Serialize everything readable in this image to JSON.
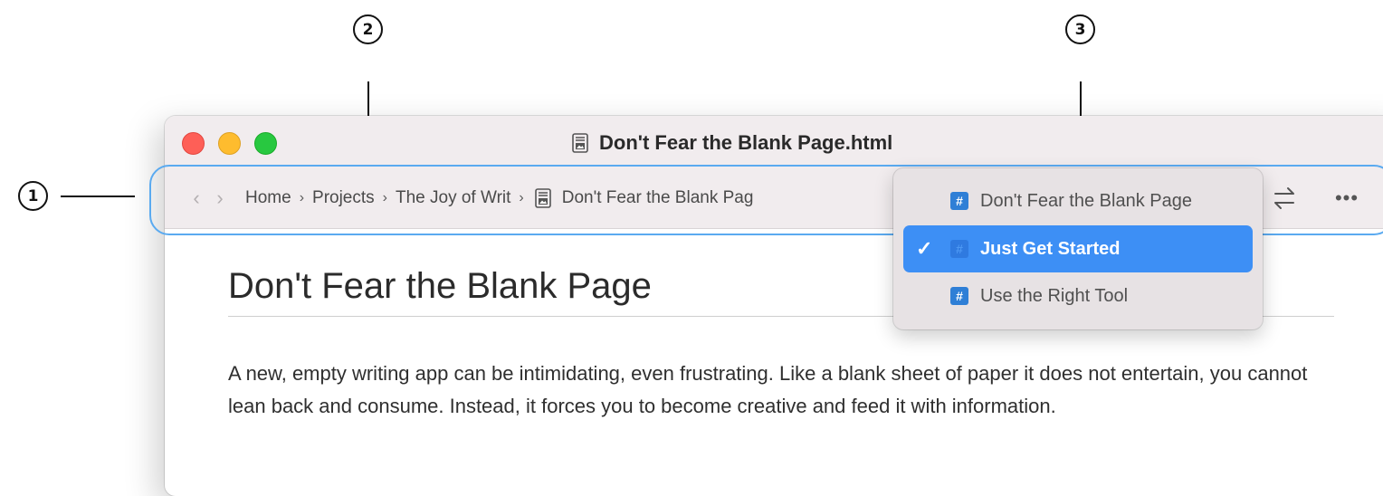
{
  "callouts": {
    "one": "1",
    "two": "2",
    "three": "3"
  },
  "window": {
    "title": "Don't Fear the Blank Page.html"
  },
  "toolbar": {
    "back": "‹",
    "forward": "›",
    "breadcrumbs": [
      "Home",
      "Projects",
      "The Joy of Writ",
      "Don't Fear the Blank Pag"
    ],
    "separator": "›",
    "more": "•••"
  },
  "menu": {
    "items": [
      {
        "label": "Don't Fear the Blank Page",
        "selected": false
      },
      {
        "label": "Just Get Started",
        "selected": true
      },
      {
        "label": "Use the Right Tool",
        "selected": false
      }
    ],
    "check": "✓",
    "hash": "#"
  },
  "document": {
    "heading": "Don't Fear the Blank Page",
    "paragraph": "A new, empty writing app can be intimidating, even frustrating. Like a blank sheet of paper it does not entertain, you cannot lean back and consume. Instead, it forces you to become creative and feed it with information."
  },
  "colors": {
    "accent": "#3d8ff5",
    "highlight_ring": "#5aaaf0",
    "titlebar": "#f1ecee"
  }
}
